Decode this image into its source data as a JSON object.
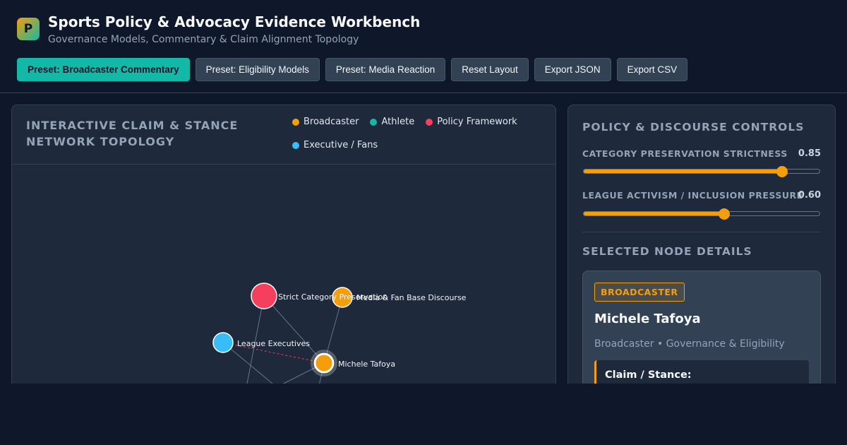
{
  "app": {
    "logo_letter": "P",
    "title": "Sports Policy & Advocacy Evidence Workbench",
    "subtitle": "Governance Models, Commentary & Claim Alignment Topology"
  },
  "toolbar": {
    "buttons": [
      {
        "label": "Preset: Broadcaster Commentary",
        "active": true
      },
      {
        "label": "Preset: Eligibility Models",
        "active": false
      },
      {
        "label": "Preset: Media Reaction",
        "active": false
      },
      {
        "label": "Reset Layout",
        "active": false
      },
      {
        "label": "Export JSON",
        "active": false
      },
      {
        "label": "Export CSV",
        "active": false
      }
    ]
  },
  "network": {
    "title": "Interactive Claim & Stance Network Topology",
    "legend": [
      {
        "label": "Broadcaster",
        "color": "#f59e0b"
      },
      {
        "label": "Athlete",
        "color": "#14b8a6"
      },
      {
        "label": "Policy Framework",
        "color": "#f43f5e"
      },
      {
        "label": "Executive / Fans",
        "color": "#38bdf8"
      }
    ],
    "nodes": [
      {
        "label": "Strict Category Preservation",
        "type": "Policy Framework"
      },
      {
        "label": "Media & Fan Base Discourse",
        "type": "Broadcaster"
      },
      {
        "label": "League Executives",
        "type": "Executive / Fans"
      },
      {
        "label": "Michele Tafoya",
        "type": "Broadcaster",
        "selected": true
      }
    ]
  },
  "controls": {
    "title": "POLICY & DISCOURSE CONTROLS",
    "sliders": [
      {
        "label": "CATEGORY PRESERVATION STRICTNESS",
        "value_text": "0.85",
        "value": 0.85
      },
      {
        "label": "LEAGUE ACTIVISM / INCLUSION PRESSURE",
        "value_text": "0.60",
        "value": 0.6
      }
    ],
    "accent_color": "#f59e0b"
  },
  "details": {
    "title": "SELECTED NODE DETAILS",
    "badge": "BROADCASTER",
    "name": "Michele Tafoya",
    "meta": "Broadcaster • Governance & Eligibility",
    "claim_title": "Claim / Stance:"
  }
}
